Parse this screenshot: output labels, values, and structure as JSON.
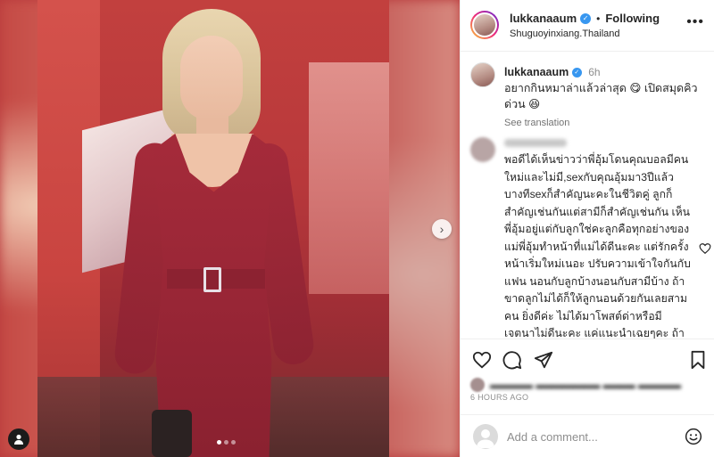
{
  "post": {
    "username": "lukkanaaum",
    "separator": "•",
    "follow_status": "Following",
    "location": "Shuguoyinxiang.Thailand",
    "more_label": "•••",
    "carousel": {
      "slide_count": 3,
      "active_slide": 1,
      "next_label": "›"
    },
    "caption": {
      "username": "lukkanaaum",
      "time": "6h",
      "text": "อยากกินหมาล่าแล้วล่าสุด 😋 เปิดสมุดคิวด่วน 😆",
      "see_translation": "See translation"
    },
    "comment": {
      "text": "พอดีได้เห็นข่าวว่าพี่อุ้มโดนคุณบอลมีคนใหม่และไม่มี,sexกับคุณอุ้มมา3ปีแล้ว บางทีsexก็สำคัญนะคะในชีวิตคู่ ลูกก็สำคัญเช่นกันแต่สามีก็สำคัญเช่นกัน เห็นพี่อุ้มอยู่แต่กับลูกใช่คะลูกคือทุกอย่างของแม่พี่อุ้มทำหน้าที่แม่ได้ดีนะคะ แต่รักครั้งหน้าเริ่มใหม่เนอะ ปรับความเข้าใจกันกับแฟน นอนกับลูกบ้างนอนกับสามีบ้าง ถ้าขาดลูกไม่ได้ก็ให้ลูกนอนด้วยกันเลยสามคน ยิ่งดีค่ะ ไม่ได้มาโพสต์ด่าหรือมีเจตนาไม่ดีนะคะ แค่แนะนำเฉยๆคะ ถ้าพิมพ์ไรผิดไปต้องขออภัยด้วยนะคะ เป็นห่วงค่ะไม่อยากให้ชีวิตคู่ของคุณอุ้มต้องเป็นแบบเดิมค่ะ"
    },
    "timestamp": "6 HOURS AGO",
    "add_comment": {
      "placeholder": "Add a comment..."
    }
  },
  "icons": {
    "verified": "verified-badge-icon",
    "like": "heart-icon",
    "comment": "comment-bubble-icon",
    "share": "paper-plane-icon",
    "save": "bookmark-icon",
    "emoji": "smiley-icon",
    "tags": "person-tag-icon",
    "next": "chevron-right-icon"
  },
  "colors": {
    "verified": "#3897f0",
    "text": "#262626",
    "muted": "#8e8e8e",
    "dress": "#a52b3a"
  }
}
